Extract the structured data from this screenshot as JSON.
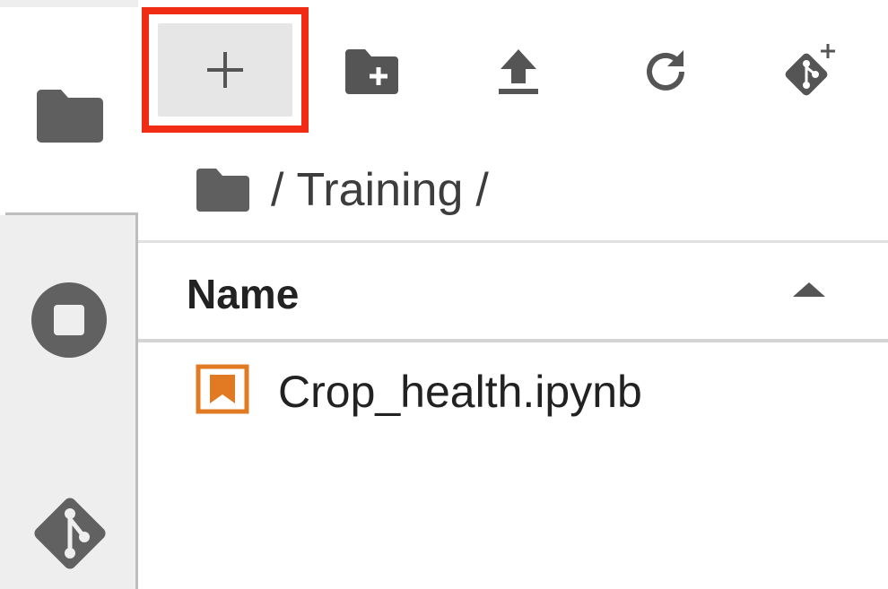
{
  "activity_bar": {
    "items": [
      {
        "name": "file-browser",
        "icon": "folder-icon",
        "active": true
      },
      {
        "name": "running-terminals-kernels",
        "icon": "stop-circle-icon",
        "active": false
      },
      {
        "name": "git",
        "icon": "git-icon",
        "active": false
      }
    ]
  },
  "toolbar": {
    "buttons": [
      {
        "name": "new-launcher",
        "icon": "plus-icon",
        "highlighted": true
      },
      {
        "name": "new-folder",
        "icon": "folder-plus-icon"
      },
      {
        "name": "upload-files",
        "icon": "upload-icon"
      },
      {
        "name": "refresh-file-list",
        "icon": "refresh-icon"
      },
      {
        "name": "git-clone",
        "icon": "git-clone-icon"
      }
    ],
    "highlight_color": "#f02d14"
  },
  "breadcrumb": {
    "root_icon": "folder-icon",
    "separator": "/",
    "path": "Training",
    "trailing_separator": "/"
  },
  "file_list": {
    "header": {
      "name_label": "Name",
      "sort_direction": "ascending"
    },
    "items": [
      {
        "name": "Crop_health.ipynb",
        "icon": "notebook-icon",
        "icon_color": "#e07b24"
      }
    ]
  }
}
